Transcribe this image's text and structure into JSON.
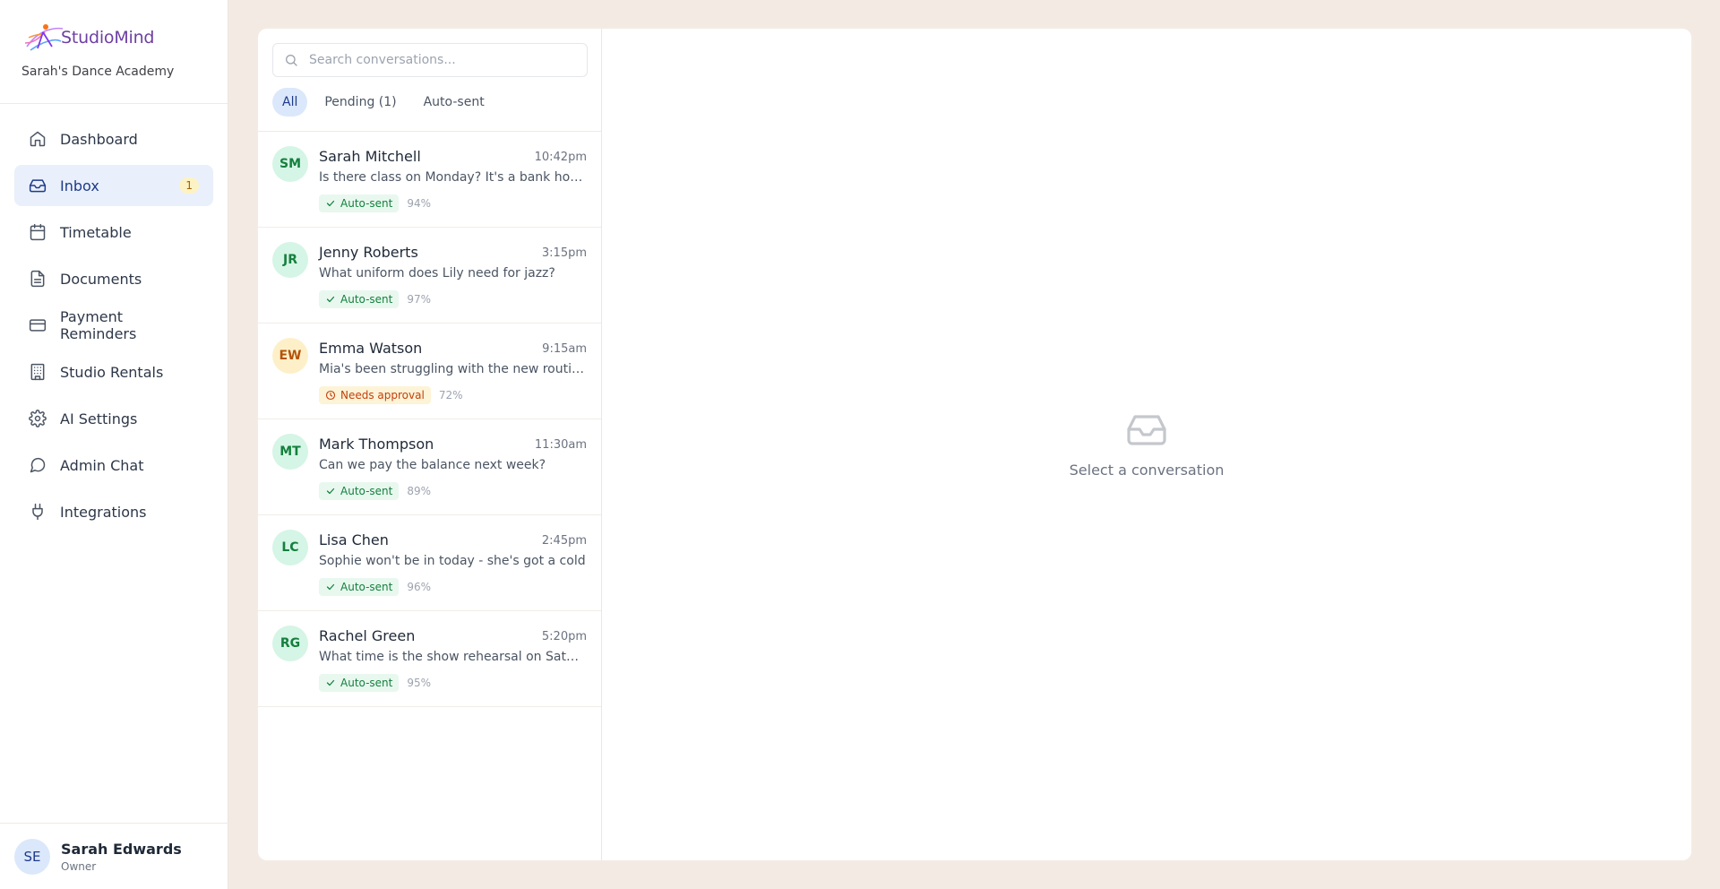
{
  "brand": {
    "name": "StudioMind",
    "academy": "Sarah's Dance Academy"
  },
  "nav": [
    {
      "label": "Dashboard",
      "icon": "home-icon"
    },
    {
      "label": "Inbox",
      "icon": "inbox-icon",
      "badge": "1",
      "active": true
    },
    {
      "label": "Timetable",
      "icon": "calendar-icon"
    },
    {
      "label": "Documents",
      "icon": "document-icon"
    },
    {
      "label": "Payment Reminders",
      "icon": "credit-card-icon"
    },
    {
      "label": "Studio Rentals",
      "icon": "building-icon"
    },
    {
      "label": "AI Settings",
      "icon": "gear-icon"
    },
    {
      "label": "Admin Chat",
      "icon": "chat-bubble-icon"
    },
    {
      "label": "Integrations",
      "icon": "plug-icon"
    }
  ],
  "user": {
    "initials": "SE",
    "name": "Sarah Edwards",
    "role": "Owner"
  },
  "search": {
    "placeholder": "Search conversations..."
  },
  "filters": [
    {
      "label": "All",
      "active": true
    },
    {
      "label": "Pending (1)"
    },
    {
      "label": "Auto-sent"
    }
  ],
  "conversations": [
    {
      "initials": "SM",
      "name": "Sarah Mitchell",
      "time": "10:42pm",
      "message": "Is there class on Monday? It's a bank holiday",
      "status": "Auto-sent",
      "confidence": "94%"
    },
    {
      "initials": "JR",
      "name": "Jenny Roberts",
      "time": "3:15pm",
      "message": "What uniform does Lily need for jazz?",
      "status": "Auto-sent",
      "confidence": "97%"
    },
    {
      "initials": "EW",
      "name": "Emma Watson",
      "time": "9:15am",
      "message": "Mia's been struggling with the new routine and wants to know if there's extra practice time",
      "status": "Needs approval",
      "confidence": "72%"
    },
    {
      "initials": "MT",
      "name": "Mark Thompson",
      "time": "11:30am",
      "message": "Can we pay the balance next week?",
      "status": "Auto-sent",
      "confidence": "89%"
    },
    {
      "initials": "LC",
      "name": "Lisa Chen",
      "time": "2:45pm",
      "message": "Sophie won't be in today - she's got a cold",
      "status": "Auto-sent",
      "confidence": "96%"
    },
    {
      "initials": "RG",
      "name": "Rachel Green",
      "time": "5:20pm",
      "message": "What time is the show rehearsal on Saturday?",
      "status": "Auto-sent",
      "confidence": "95%"
    }
  ],
  "empty_state": {
    "text": "Select a conversation",
    "icon": "inbox-tray-icon"
  },
  "colors": {
    "background": "#f3ebe3",
    "active_nav": "#e9f0fb",
    "auto_sent": "#15803d",
    "needs_approval": "#c2410c",
    "brand": "#6d3fa3"
  }
}
